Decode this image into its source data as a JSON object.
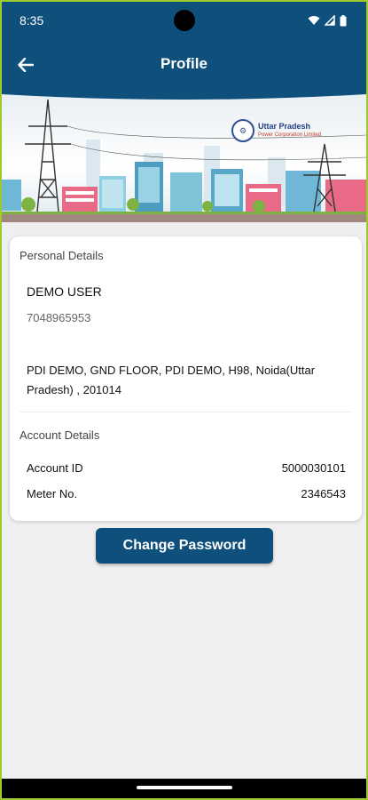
{
  "status_bar": {
    "time": "8:35"
  },
  "app_bar": {
    "title": "Profile"
  },
  "banner": {
    "logo_line1": "Uttar Pradesh",
    "logo_line2": "Power Corporation Limited"
  },
  "personal": {
    "title": "Personal Details",
    "name": "DEMO USER",
    "phone": "7048965953",
    "address": "PDI DEMO, GND FLOOR, PDI DEMO, H98, Noida(Uttar Pradesh) , 201014"
  },
  "account": {
    "title": "Account Details",
    "rows": [
      {
        "label": "Account ID",
        "value": "5000030101"
      },
      {
        "label": "Meter No.",
        "value": "2346543"
      }
    ]
  },
  "actions": {
    "change_password": "Change Password"
  },
  "colors": {
    "primary": "#0e4f7c",
    "frame": "#9ecb2b"
  }
}
